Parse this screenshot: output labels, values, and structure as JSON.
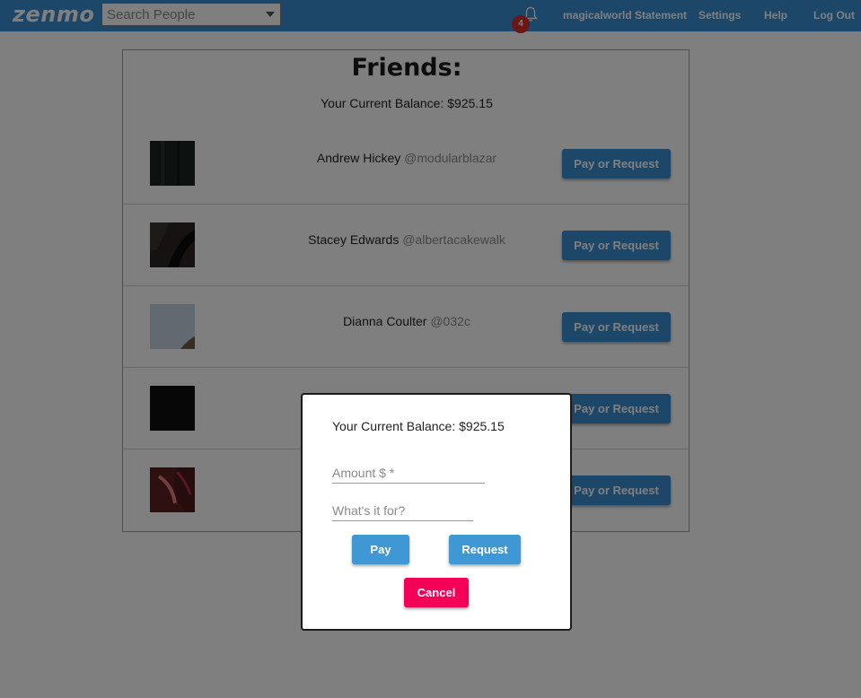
{
  "app": {
    "logo": "zenmo"
  },
  "search": {
    "placeholder": "Search People"
  },
  "notifications": {
    "count": "4"
  },
  "nav": {
    "user": "magicalworld",
    "statement": "Statement",
    "settings": "Settings",
    "help": "Help",
    "logout": "Log Out"
  },
  "page": {
    "title": "Friends:",
    "balance": "Your Current Balance: $925.15"
  },
  "friends": [
    {
      "name": "Andrew Hickey",
      "handle": "@modularblazar",
      "button": "Pay or Request"
    },
    {
      "name": "Stacey Edwards",
      "handle": "@albertacakewalk",
      "button": "Pay or Request"
    },
    {
      "name": "Dianna Coulter",
      "handle": "@032c",
      "button": "Pay or Request"
    },
    {
      "name": "",
      "handle": "",
      "button": "Pay or Request"
    },
    {
      "name": "",
      "handle": "",
      "button": "Pay or Request"
    }
  ],
  "modal": {
    "balance": "Your Current Balance: $925.15",
    "amount_placeholder": "Amount $ *",
    "note_placeholder": "What's it for?",
    "pay": "Pay",
    "request": "Request",
    "cancel": "Cancel"
  },
  "colors": {
    "brand": "#3a8fd2",
    "badge": "#d32f2f",
    "cancel": "#f50057",
    "modal_button": "#3f97d4"
  }
}
